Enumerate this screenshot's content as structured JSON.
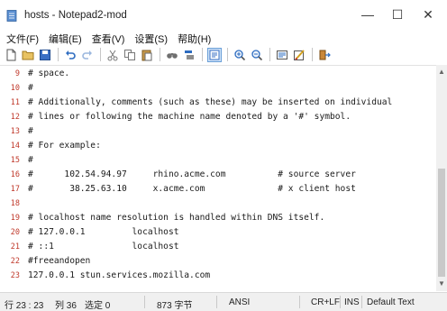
{
  "window": {
    "title": "hosts - Notepad2-mod",
    "controls": {
      "minimize": "—",
      "maximize": "☐",
      "close": "✕"
    }
  },
  "menu": [
    "文件(F)",
    "编辑(E)",
    "查看(V)",
    "设置(S)",
    "帮助(H)"
  ],
  "toolbar": {
    "buttons": [
      "new-file",
      "open-folder",
      "save",
      "undo",
      "redo",
      "cut",
      "copy",
      "paste",
      "find",
      "replace",
      "word-wrap",
      "zoom-in",
      "zoom-out",
      "schemes",
      "customize-schemes",
      "exit"
    ],
    "active": "word-wrap"
  },
  "editor": {
    "lines": [
      {
        "n": "9",
        "text": "# space."
      },
      {
        "n": "10",
        "text": "#"
      },
      {
        "n": "11",
        "text": "# Additionally, comments (such as these) may be inserted on individual"
      },
      {
        "n": "12",
        "text": "# lines or following the machine name denoted by a '#' symbol."
      },
      {
        "n": "13",
        "text": "#"
      },
      {
        "n": "14",
        "text": "# For example:"
      },
      {
        "n": "15",
        "text": "#"
      },
      {
        "n": "16",
        "text": "#      102.54.94.97     rhino.acme.com          # source server"
      },
      {
        "n": "17",
        "text": "#       38.25.63.10     x.acme.com              # x client host"
      },
      {
        "n": "18",
        "text": ""
      },
      {
        "n": "19",
        "text": "# localhost name resolution is handled within DNS itself."
      },
      {
        "n": "20",
        "text": "# 127.0.0.1         localhost"
      },
      {
        "n": "21",
        "text": "# ::1               localhost"
      },
      {
        "n": "22",
        "text": "#freeandopen"
      },
      {
        "n": "23",
        "text": "127.0.0.1 stun.services.mozilla.com"
      }
    ]
  },
  "status": {
    "position": "行 23 : 23",
    "column": "列 36",
    "selection": "选定 0",
    "size": "873 字节",
    "encoding": "ANSI",
    "eol": "CR+LF",
    "mode": "INS",
    "scheme": "Default Text"
  },
  "colors": {
    "line_number": "#c0392b",
    "active_button_bg": "#cfe3f7"
  }
}
